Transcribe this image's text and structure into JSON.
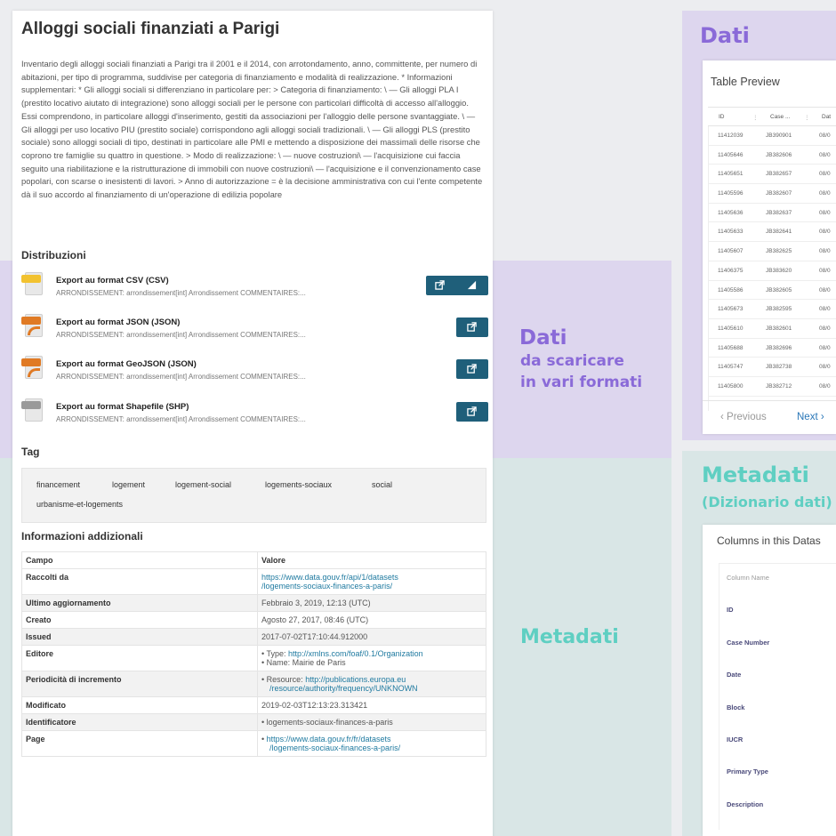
{
  "panel": {
    "title": "Alloggi sociali finanziati a Parigi",
    "description": "Inventario degli alloggi sociali finanziati a Parigi tra il 2001 e il 2014, con arrotondamento, anno, committente, per numero di abitazioni, per tipo di programma, suddivise per categoria di finanziamento e modalità di realizzazione. * Informazioni supplementari: * Gli alloggi sociali si differenziano in particolare per: > Categoria di finanziamento: \\ — Gli alloggi PLA I (prestito locativo aiutato di integrazione) sono alloggi sociali per le persone con particolari difficoltà di accesso all'alloggio. Essi comprendono, in particolare alloggi d'inserimento, gestiti da associazioni per l'alloggio delle persone svantaggiate. \\ — Gli alloggi per uso locativo PIU (prestito sociale) corrispondono agli alloggi sociali tradizionali. \\ — Gli alloggi PLS (prestito sociale) sono alloggi sociali di tipo, destinati in particolare alle PMI e mettendo a disposizione dei massimali delle risorse che coprono tre famiglie su quattro in questione. > Modo di realizzazione: \\ — nuove costruzioni\\ — l'acquisizione cui faccia seguito una riabilitazione e la ristrutturazione di immobili con nuove costruzioni\\ — l'acquisizione e il convenzionamento case popolari, con scarse o inesistenti di lavori. > Anno di autorizzazione = è la decisione amministrativa con cui l'ente competente dà il suo accordo al finanziamento di un'operazione di edilizia popolare",
    "distribuzioni_heading": "Distribuzioni",
    "distributions": [
      {
        "name": "Export au format CSV (CSV)",
        "desc": "ARRONDISSEMENT: arrondissement[int] Arrondissement COMMENTAIRES:...",
        "icon": "csv-file-icon"
      },
      {
        "name": "Export au format JSON (JSON)",
        "desc": "ARRONDISSEMENT: arrondissement[int] Arrondissement COMMENTAIRES:...",
        "icon": "json-file-icon"
      },
      {
        "name": "Export au format GeoJSON (JSON)",
        "desc": "ARRONDISSEMENT: arrondissement[int] Arrondissement COMMENTAIRES:...",
        "icon": "json-file-icon"
      },
      {
        "name": "Export au format Shapefile (SHP)",
        "desc": "ARRONDISSEMENT: arrondissement[int] Arrondissement COMMENTAIRES:...",
        "icon": "shp-file-icon"
      }
    ],
    "tag_heading": "Tag",
    "tags": [
      "financement",
      "logement",
      "logement-social",
      "logements-sociaux",
      "social",
      "urbanisme-et-logements"
    ],
    "info_heading": "Informazioni addizionali",
    "info_table": {
      "col_field": "Campo",
      "col_value": "Valore",
      "rows": [
        {
          "k": "Raccolti da",
          "v1": "https://www.data.gouv.fr/api/1/datasets",
          "v2": "/logements-sociaux-finances-a-paris/"
        },
        {
          "k": "Ultimo aggiornamento",
          "v1": "Febbraio 3, 2019, 12:13 (UTC)"
        },
        {
          "k": "Creato",
          "v1": "Agosto 27, 2017, 08:46 (UTC)"
        },
        {
          "k": "Issued",
          "v1": "2017-07-02T17:10:44.912000"
        },
        {
          "k": "Editore",
          "b1_label": "Type:",
          "b1_link": "http://xmlns.com/foaf/0.1/Organization",
          "b2": "Name: Mairie de Paris"
        },
        {
          "k": "Periodicità di incremento",
          "b1_label": "Resource:",
          "b1_link": "http://publications.europa.eu",
          "b1_link2": "/resource/authority/frequency/UNKNOWN"
        },
        {
          "k": "Modificato",
          "v1": "2019-02-03T12:13:23.313421"
        },
        {
          "k": "Identificatore",
          "b1": "logements-sociaux-finances-a-paris"
        },
        {
          "k": "Page",
          "b1_link": "https://www.data.gouv.fr/fr/datasets",
          "b1_link2": "/logements-sociaux-finances-a-paris/"
        }
      ]
    }
  },
  "annotations": {
    "dati_top": "Dati",
    "dati_mid": "Dati",
    "dati_sub1": "da scaricare",
    "dati_sub2": "in vari formati",
    "metadati_right": "Metadati",
    "metadati_right_sub": "(Dizionario dati)",
    "metadati_left": "Metadati"
  },
  "table_preview": {
    "title": "Table Preview",
    "headers": [
      "ID",
      "Case ...",
      "Dat"
    ],
    "rows": [
      [
        "11412039",
        "JB390901",
        "08/0"
      ],
      [
        "11405646",
        "JB382606",
        "08/0"
      ],
      [
        "11405651",
        "JB382657",
        "08/0"
      ],
      [
        "11405596",
        "JB382607",
        "08/0"
      ],
      [
        "11405636",
        "JB382637",
        "08/0"
      ],
      [
        "11405633",
        "JB382641",
        "08/0"
      ],
      [
        "11405607",
        "JB382625",
        "08/0"
      ],
      [
        "11406375",
        "JB383620",
        "08/0"
      ],
      [
        "11405586",
        "JB382605",
        "08/0"
      ],
      [
        "11405673",
        "JB382595",
        "08/0"
      ],
      [
        "11405610",
        "JB382601",
        "08/0"
      ],
      [
        "11405688",
        "JB382696",
        "08/0"
      ],
      [
        "11405747",
        "JB382738",
        "08/0"
      ],
      [
        "11405800",
        "JB382712",
        "08/0"
      ]
    ],
    "previous": "Previous",
    "next": "Next"
  },
  "columns_card": {
    "title": "Columns in this Datas",
    "header": "Column Name",
    "items": [
      "ID",
      "Case Number",
      "Date",
      "Block",
      "IUCR",
      "Primary Type",
      "Description"
    ]
  },
  "colors": {
    "purple_band": "#ddd6ee",
    "teal_band": "#d9e6e6",
    "purple_label": "#8a6ad8",
    "teal_label": "#5fcfc2",
    "button": "#1f5f7a",
    "link": "#1f7aa0"
  }
}
